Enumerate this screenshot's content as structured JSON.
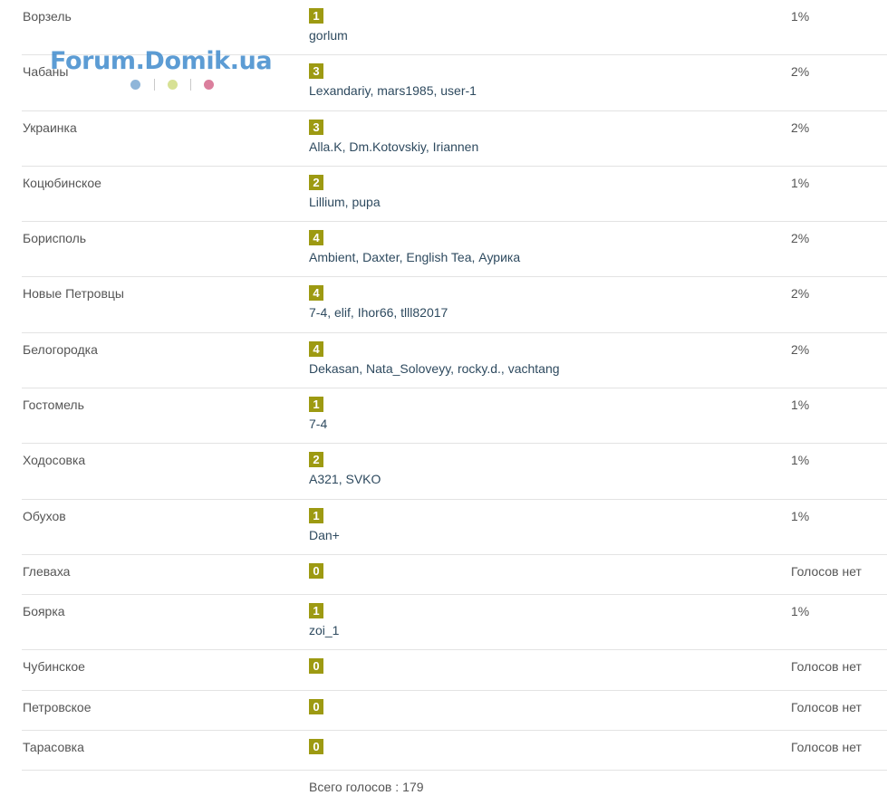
{
  "watermark": {
    "text": "Forum.Domik.ua",
    "dot_colors": [
      "#8fb6d9",
      "#d7e195",
      "#db7f9d"
    ]
  },
  "accent_color": "#9d9a12",
  "rows": [
    {
      "city": "Ворзель",
      "count": "1",
      "voters": "gorlum",
      "percent": "1%"
    },
    {
      "city": "Чабаны",
      "count": "3",
      "voters": "Lexandariy, mars1985, user-1",
      "percent": "2%"
    },
    {
      "city": "Украинка",
      "count": "3",
      "voters": "Alla.K, Dm.Kotovskiy, Iriannen",
      "percent": "2%"
    },
    {
      "city": "Коцюбинское",
      "count": "2",
      "voters": "Lillium, pupa",
      "percent": "1%"
    },
    {
      "city": "Борисполь",
      "count": "4",
      "voters": "Ambient, Daxter, English Tea, Аурика",
      "percent": "2%"
    },
    {
      "city": "Новые Петровцы",
      "count": "4",
      "voters": "7-4, elif, Ihor66, tlll82017",
      "percent": "2%"
    },
    {
      "city": "Белогородка",
      "count": "4",
      "voters": "Dekasan, Nata_Soloveyy, rocky.d., vachtang",
      "percent": "2%"
    },
    {
      "city": "Гостомель",
      "count": "1",
      "voters": "7-4",
      "percent": "1%"
    },
    {
      "city": "Ходосовка",
      "count": "2",
      "voters": "A321, SVKO",
      "percent": "1%"
    },
    {
      "city": "Обухов",
      "count": "1",
      "voters": "Dan+",
      "percent": "1%"
    },
    {
      "city": "Глеваха",
      "count": "0",
      "voters": "",
      "percent": "Голосов нет"
    },
    {
      "city": "Боярка",
      "count": "1",
      "voters": "zoi_1",
      "percent": "1%"
    },
    {
      "city": "Чубинское",
      "count": "0",
      "voters": "",
      "percent": "Голосов нет"
    },
    {
      "city": "Петровское",
      "count": "0",
      "voters": "",
      "percent": "Голосов нет"
    },
    {
      "city": "Тарасовка",
      "count": "0",
      "voters": "",
      "percent": "Голосов нет"
    }
  ],
  "total": {
    "label": "Всего голосов :",
    "value": "179"
  }
}
